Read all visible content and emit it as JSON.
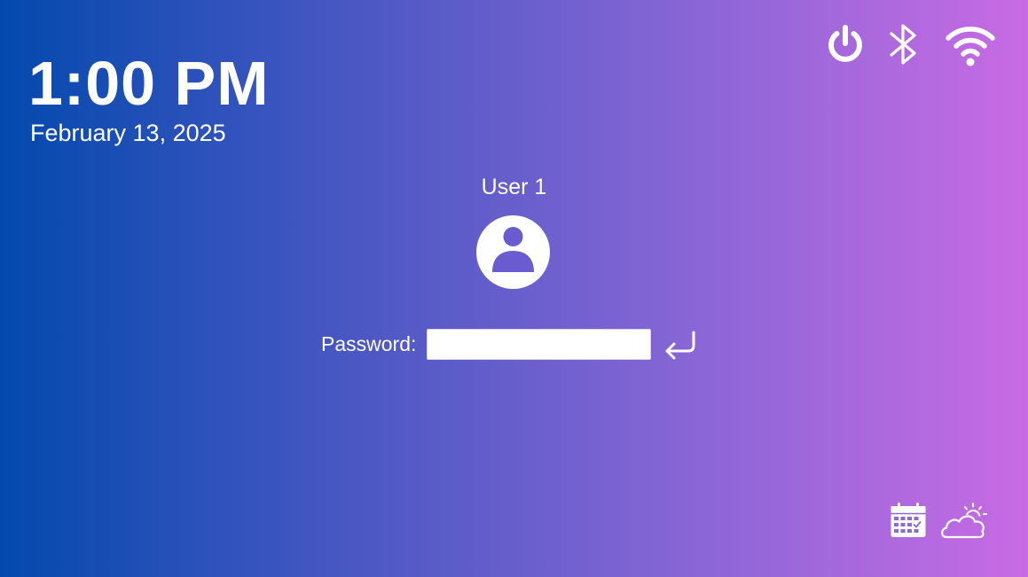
{
  "clock": {
    "time": "1:00 PM",
    "date": "February 13, 2025"
  },
  "status_icons": [
    "power-icon",
    "bluetooth-icon",
    "wifi-icon"
  ],
  "login": {
    "username": "User 1",
    "password_label": "Password:",
    "password_value": "",
    "password_placeholder": ""
  },
  "widgets": [
    "calendar-icon",
    "weather-icon"
  ],
  "colors": {
    "gradient_start": "#0349ad",
    "gradient_end": "#c86be4",
    "avatar_figure": "#6a5bd0",
    "foreground": "#ffffff"
  }
}
